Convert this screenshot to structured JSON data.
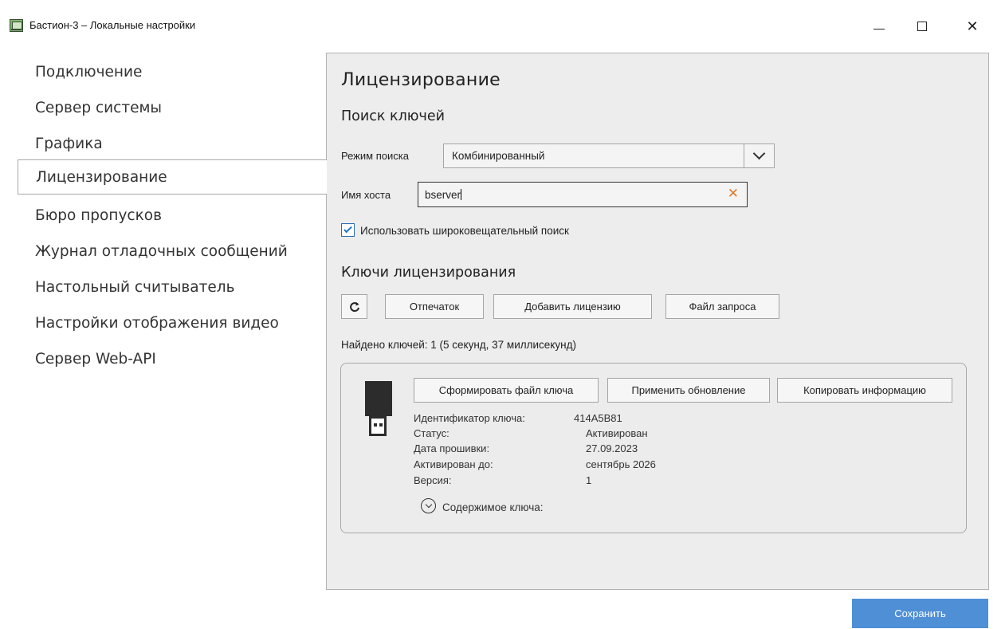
{
  "window": {
    "title": "Бастион-3 – Локальные настройки",
    "minimize_glyph": "—",
    "maximize_glyph": "☐",
    "close_glyph": "✕"
  },
  "sidebar": {
    "items": [
      {
        "label": "Подключение",
        "active": false
      },
      {
        "label": "Сервер системы",
        "active": false
      },
      {
        "label": "Графика",
        "active": false
      },
      {
        "label": "Лицензирование",
        "active": true
      },
      {
        "label": "Бюро пропусков",
        "active": false
      },
      {
        "label": "Журнал отладочных сообщений",
        "active": false
      },
      {
        "label": "Настольный считыватель",
        "active": false
      },
      {
        "label": "Настройки отображения видео",
        "active": false
      },
      {
        "label": "Сервер Web-API",
        "active": false
      }
    ]
  },
  "main": {
    "title": "Лицензирование",
    "search_section": "Поиск ключей",
    "search_mode_label": "Режим поиска",
    "search_mode_value": "Комбинированный",
    "host_label": "Имя хоста",
    "host_value": "bserver",
    "broadcast_label": "Использовать широковещательный поиск",
    "broadcast_checked": true,
    "keys_section": "Ключи лицензирования",
    "buttons": {
      "refresh_icon": "refresh-icon",
      "fingerprint": "Отпечаток",
      "add_license": "Добавить лицензию",
      "request_file": "Файл запроса"
    },
    "found_text": "Найдено ключей: 1 (5 секунд, 37 миллисекунд)",
    "key_card": {
      "actions": {
        "make_key_file": "Сформировать файл ключа",
        "apply_update": "Применить обновление",
        "copy_info": "Копировать информацию"
      },
      "fields": [
        {
          "label": "Идентификатор ключа:",
          "value": "414A5B81"
        },
        {
          "label": "Статус:",
          "value": "Активирован"
        },
        {
          "label": "Дата прошивки:",
          "value": "27.09.2023"
        },
        {
          "label": "Активирован до:",
          "value": "сентябрь 2026"
        },
        {
          "label": "Версия:",
          "value": "1"
        }
      ],
      "contents_label": "Содержимое ключа:"
    }
  },
  "footer": {
    "save_label": "Сохранить"
  },
  "colors": {
    "accent": "#4f8fd6",
    "clear_icon": "#e07a2a",
    "panel_bg": "#ededed"
  }
}
